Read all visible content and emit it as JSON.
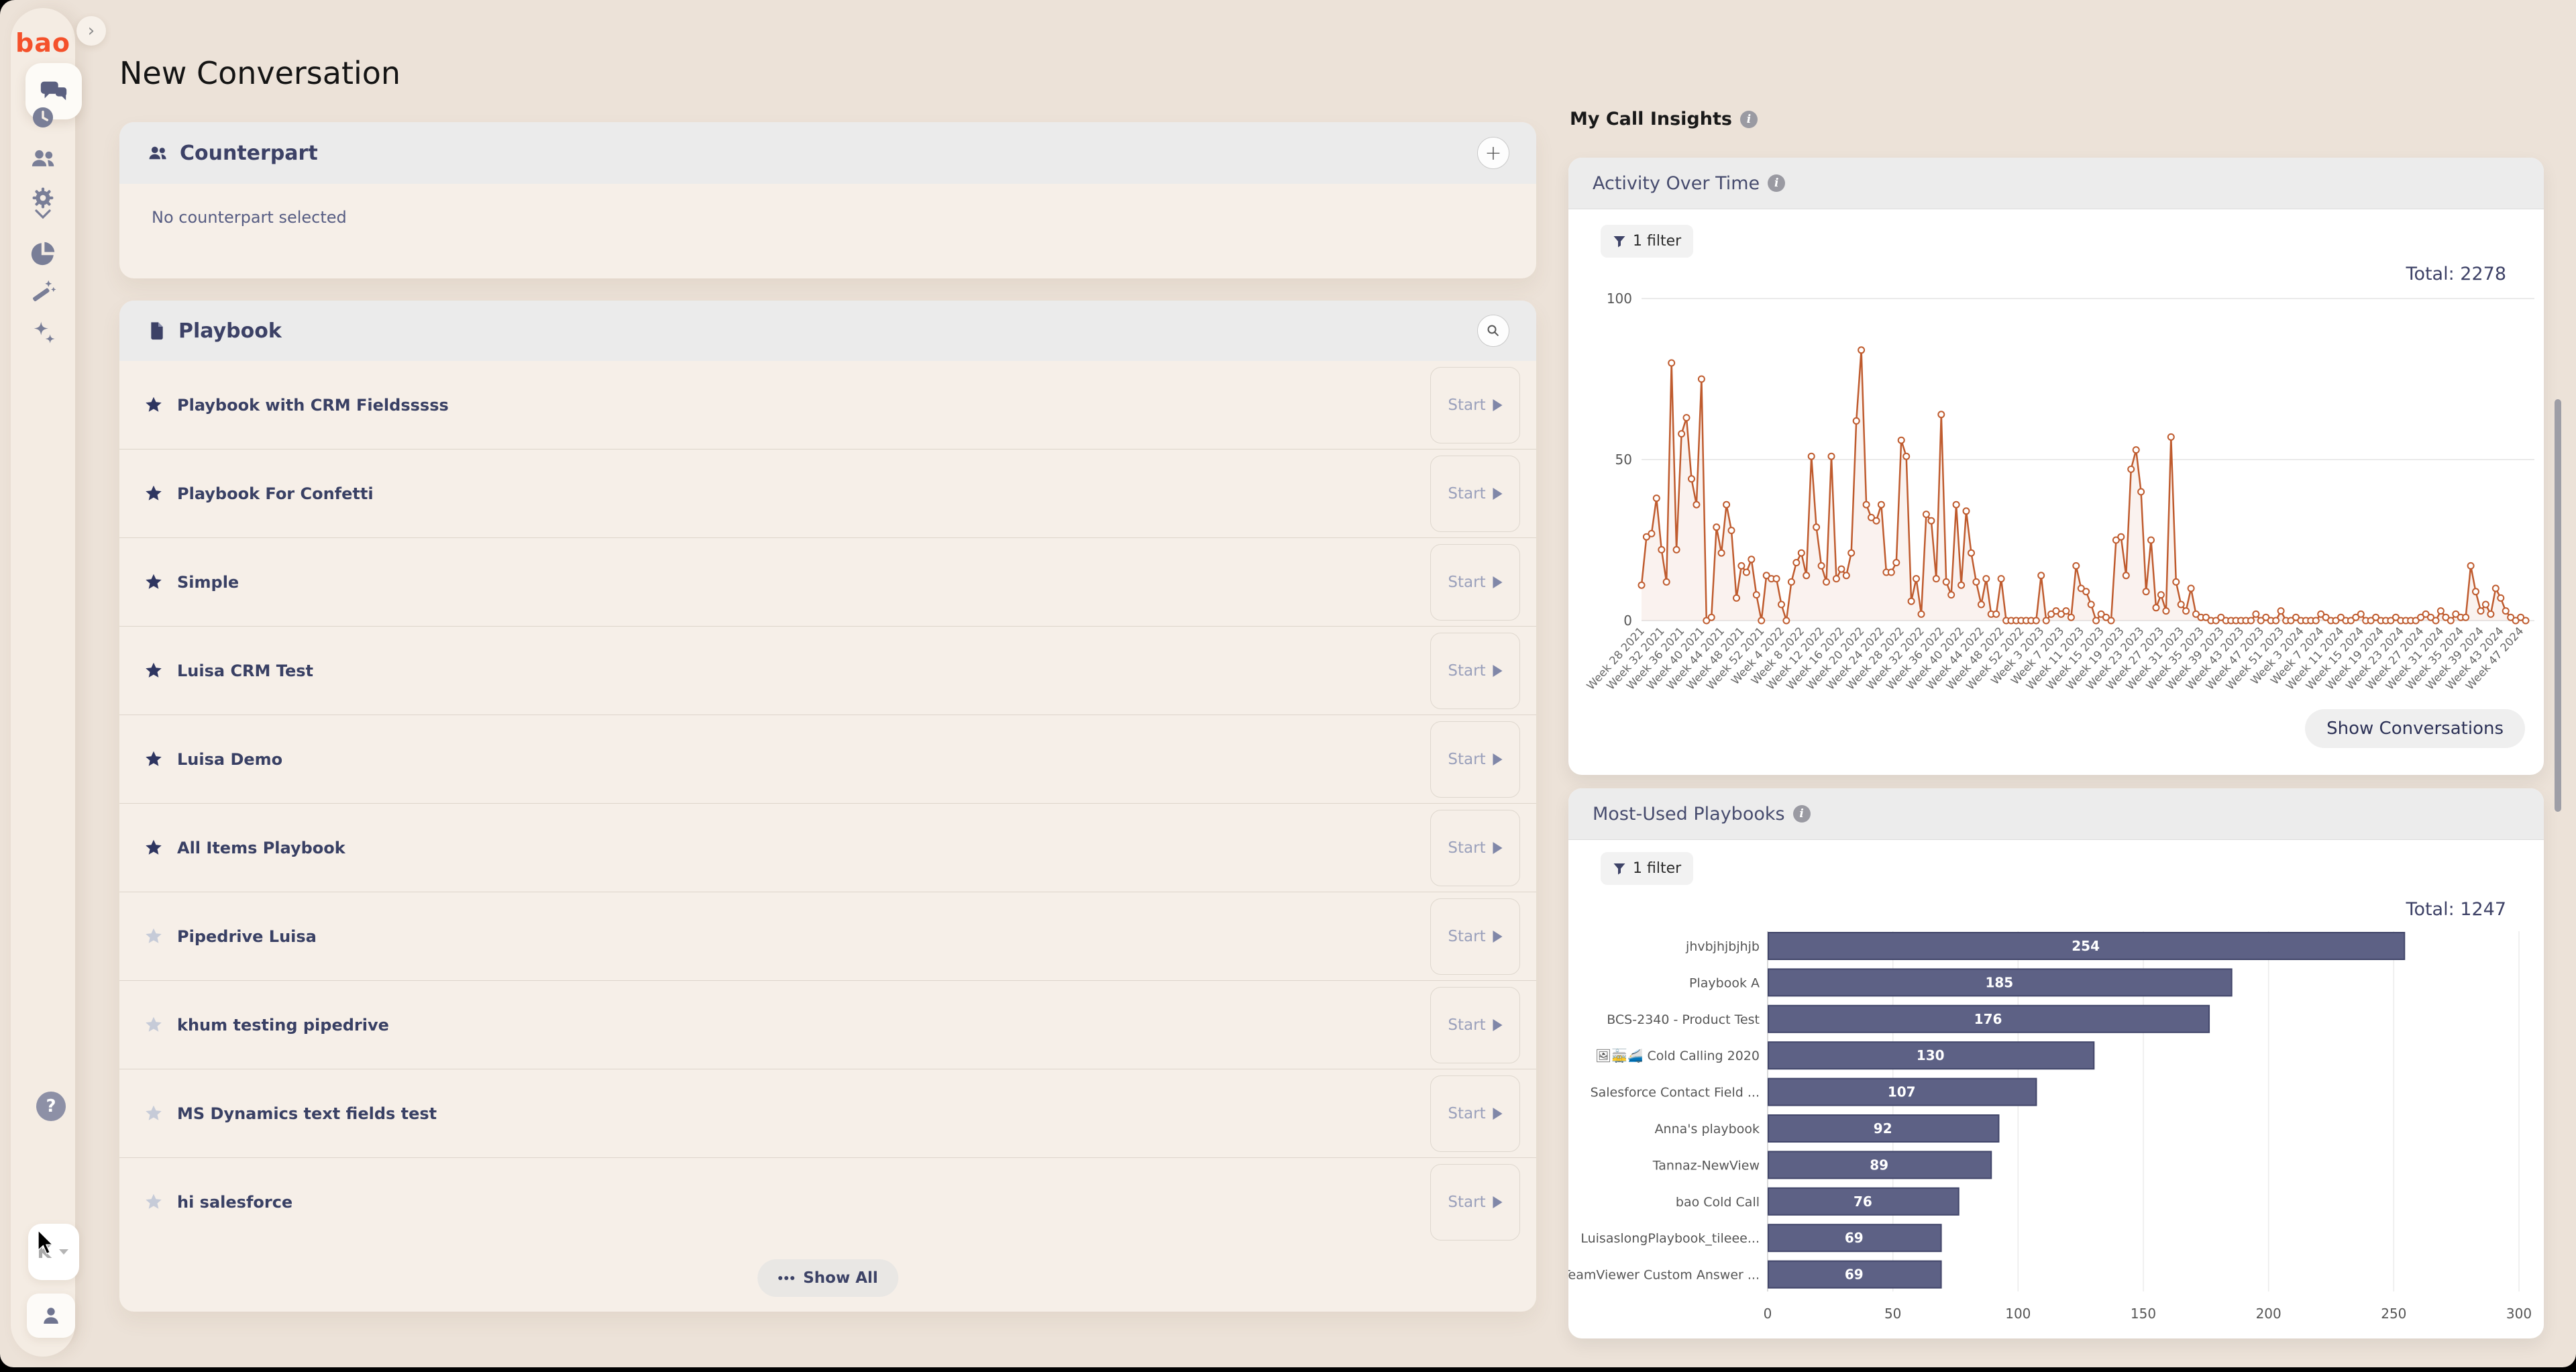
{
  "sidebar": {
    "logo": "bao",
    "language_selector": "K"
  },
  "main": {
    "title": "New Conversation",
    "counterpart": {
      "title": "Counterpart",
      "empty_text": "No counterpart selected"
    },
    "playbook": {
      "title": "Playbook",
      "start_label": "Start",
      "show_all_label": "Show All",
      "items": [
        {
          "name": "Playbook with CRM Fieldsssss",
          "starred": true
        },
        {
          "name": "Playbook For Confetti",
          "starred": true
        },
        {
          "name": "Simple",
          "starred": true
        },
        {
          "name": "Luisa CRM Test",
          "starred": true
        },
        {
          "name": "Luisa Demo",
          "starred": true
        },
        {
          "name": "All Items Playbook",
          "starred": true
        },
        {
          "name": "Pipedrive Luisa",
          "starred": false
        },
        {
          "name": "khum testing pipedrive",
          "starred": false
        },
        {
          "name": "MS Dynamics text fields test",
          "starred": false
        },
        {
          "name": "hi salesforce",
          "starred": false
        }
      ]
    }
  },
  "insights": {
    "title": "My Call Insights",
    "activity": {
      "title": "Activity Over Time",
      "filter_label": "1 filter",
      "total_label": "Total: 2278",
      "show_conversations_label": "Show Conversations"
    },
    "most_used": {
      "title": "Most-Used Playbooks",
      "filter_label": "1 filter",
      "total_label": "Total: 1247"
    }
  },
  "chart_data": [
    {
      "type": "line",
      "title": "Activity Over Time",
      "total": 2278,
      "ylim": [
        0,
        100
      ],
      "yticks": [
        0,
        50,
        100
      ],
      "color": "#bf5b2e",
      "x_tick_label_every": 4,
      "x_labels": [
        "Week 28 2021",
        "Week 32 2021",
        "Week 36 2021",
        "Week 40 2021",
        "Week 44 2021",
        "Week 48 2021",
        "Week 52 2021",
        "Week 4 2022",
        "Week 8 2022",
        "Week 12 2022",
        "Week 16 2022",
        "Week 20 2022",
        "Week 24 2022",
        "Week 28 2022",
        "Week 32 2022",
        "Week 36 2022",
        "Week 40 2022",
        "Week 44 2022",
        "Week 48 2022",
        "Week 52 2022",
        "Week 3 2023",
        "Week 7 2023",
        "Week 11 2023",
        "Week 15 2023",
        "Week 19 2023",
        "Week 23 2023",
        "Week 27 2023",
        "Week 31 2023",
        "Week 35 2023",
        "Week 39 2023",
        "Week 43 2023",
        "Week 47 2023",
        "Week 51 2023",
        "Week 3 2024",
        "Week 7 2024",
        "Week 11 2024",
        "Week 15 2024",
        "Week 19 2024",
        "Week 23 2024",
        "Week 27 2024",
        "Week 31 2024",
        "Week 35 2024",
        "Week 39 2024",
        "Week 43 2024",
        "Week 47 2024"
      ],
      "values": [
        11,
        26,
        27,
        38,
        22,
        12,
        80,
        22,
        58,
        63,
        44,
        36,
        75,
        0,
        1,
        29,
        21,
        36,
        28,
        7,
        17,
        15,
        19,
        8,
        0,
        14,
        13,
        13,
        5,
        0,
        12,
        18,
        21,
        14,
        51,
        29,
        17,
        12,
        51,
        13,
        16,
        14,
        21,
        62,
        84,
        36,
        32,
        31,
        36,
        15,
        15,
        18,
        56,
        51,
        6,
        13,
        2,
        33,
        31,
        13,
        64,
        12,
        8,
        36,
        11,
        34,
        21,
        12,
        5,
        13,
        2,
        2,
        13,
        0,
        0,
        0,
        0,
        0,
        0,
        0,
        14,
        0,
        2,
        3,
        2,
        3,
        1,
        17,
        10,
        9,
        5,
        0,
        2,
        1,
        0,
        25,
        26,
        14,
        47,
        53,
        40,
        9,
        25,
        4,
        8,
        3,
        57,
        12,
        5,
        3,
        10,
        2,
        1,
        1,
        0,
        0,
        1,
        0,
        0,
        0,
        0,
        0,
        0,
        2,
        0,
        1,
        0,
        0,
        3,
        0,
        0,
        1,
        0,
        0,
        0,
        0,
        2,
        1,
        0,
        0,
        1,
        0,
        0,
        1,
        2,
        0,
        0,
        1,
        0,
        0,
        0,
        1,
        0,
        0,
        0,
        0,
        1,
        2,
        1,
        0,
        3,
        1,
        0,
        2,
        1,
        1,
        17,
        9,
        3,
        5,
        2,
        10,
        7,
        3,
        1,
        0,
        1,
        0
      ]
    },
    {
      "type": "bar",
      "orientation": "horizontal",
      "title": "Most-Used Playbooks",
      "total": 1247,
      "xlim": [
        0,
        300
      ],
      "xticks": [
        0,
        50,
        100,
        150,
        200,
        250,
        300
      ],
      "color": "#5d6185",
      "categories": [
        "jhvbjhjbjhjb",
        "Playbook A",
        "BCS-2340 - Product Test",
        "🖼🚋🚄 Cold Calling 2020",
        "Salesforce Contact Field ...",
        "Anna's playbook",
        "Tannaz-NewView",
        "bao Cold Call",
        "LuisaslongPlaybook_tileee...",
        "TeamViewer Custom Answer ..."
      ],
      "values": [
        254,
        185,
        176,
        130,
        107,
        92,
        89,
        76,
        69,
        69
      ]
    }
  ]
}
